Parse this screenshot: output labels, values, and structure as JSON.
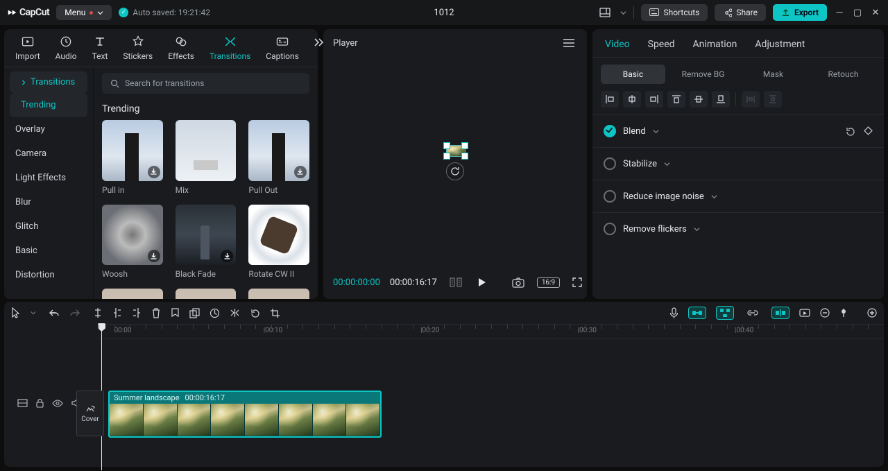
{
  "app": {
    "name": "CapCut",
    "menu": "Menu",
    "autosave": "Auto saved: 19:21:42",
    "project": "1012"
  },
  "titlebar": {
    "shortcuts": "Shortcuts",
    "share": "Share",
    "export": "Export"
  },
  "left": {
    "tabs": [
      "Import",
      "Audio",
      "Text",
      "Stickers",
      "Effects",
      "Transitions",
      "Captions"
    ],
    "activeTab": 5,
    "searchPlaceholder": "Search for transitions",
    "catsHeader": "Transitions",
    "cats": [
      "Trending",
      "Overlay",
      "Camera",
      "Light Effects",
      "Blur",
      "Glitch",
      "Basic",
      "Distortion"
    ],
    "activeCat": 0,
    "section": "Trending",
    "items": [
      {
        "label": "Pull in",
        "cls": "sky",
        "dl": true
      },
      {
        "label": "Mix",
        "cls": "mix"
      },
      {
        "label": "Pull Out",
        "cls": "sky",
        "dl": true
      },
      {
        "label": "Woosh",
        "cls": "blur",
        "dl": true
      },
      {
        "label": "Black Fade",
        "cls": "bfade",
        "dl": true
      },
      {
        "label": "Rotate CW II",
        "cls": "rot"
      },
      {
        "label": "",
        "cls": "stub"
      },
      {
        "label": "",
        "cls": "stub"
      },
      {
        "label": "",
        "cls": "stub"
      }
    ]
  },
  "player": {
    "title": "Player",
    "cur": "00:00:00:00",
    "dur": "00:00:16:17",
    "ratio": "16:9"
  },
  "right": {
    "tabs": [
      "Video",
      "Speed",
      "Animation",
      "Adjustment"
    ],
    "activeTab": 0,
    "subs": [
      "Basic",
      "Remove BG",
      "Mask",
      "Retouch"
    ],
    "activeSub": 0,
    "rows": [
      {
        "label": "Blend",
        "on": true,
        "reset": true
      },
      {
        "label": "Stabilize",
        "on": false
      },
      {
        "label": "Reduce image noise",
        "on": false
      },
      {
        "label": "Remove flickers",
        "on": false
      }
    ]
  },
  "timeline": {
    "ticks": [
      {
        "p": 2,
        "l": "00:00"
      },
      {
        "p": 21,
        "l": "|00:10"
      },
      {
        "p": 41,
        "l": "|00:20"
      },
      {
        "p": 61,
        "l": "|00:30"
      },
      {
        "p": 81,
        "l": "|00:40"
      }
    ],
    "clip": {
      "name": "Summer landscape",
      "dur": "00:00:16:17"
    },
    "cover": "Cover"
  }
}
